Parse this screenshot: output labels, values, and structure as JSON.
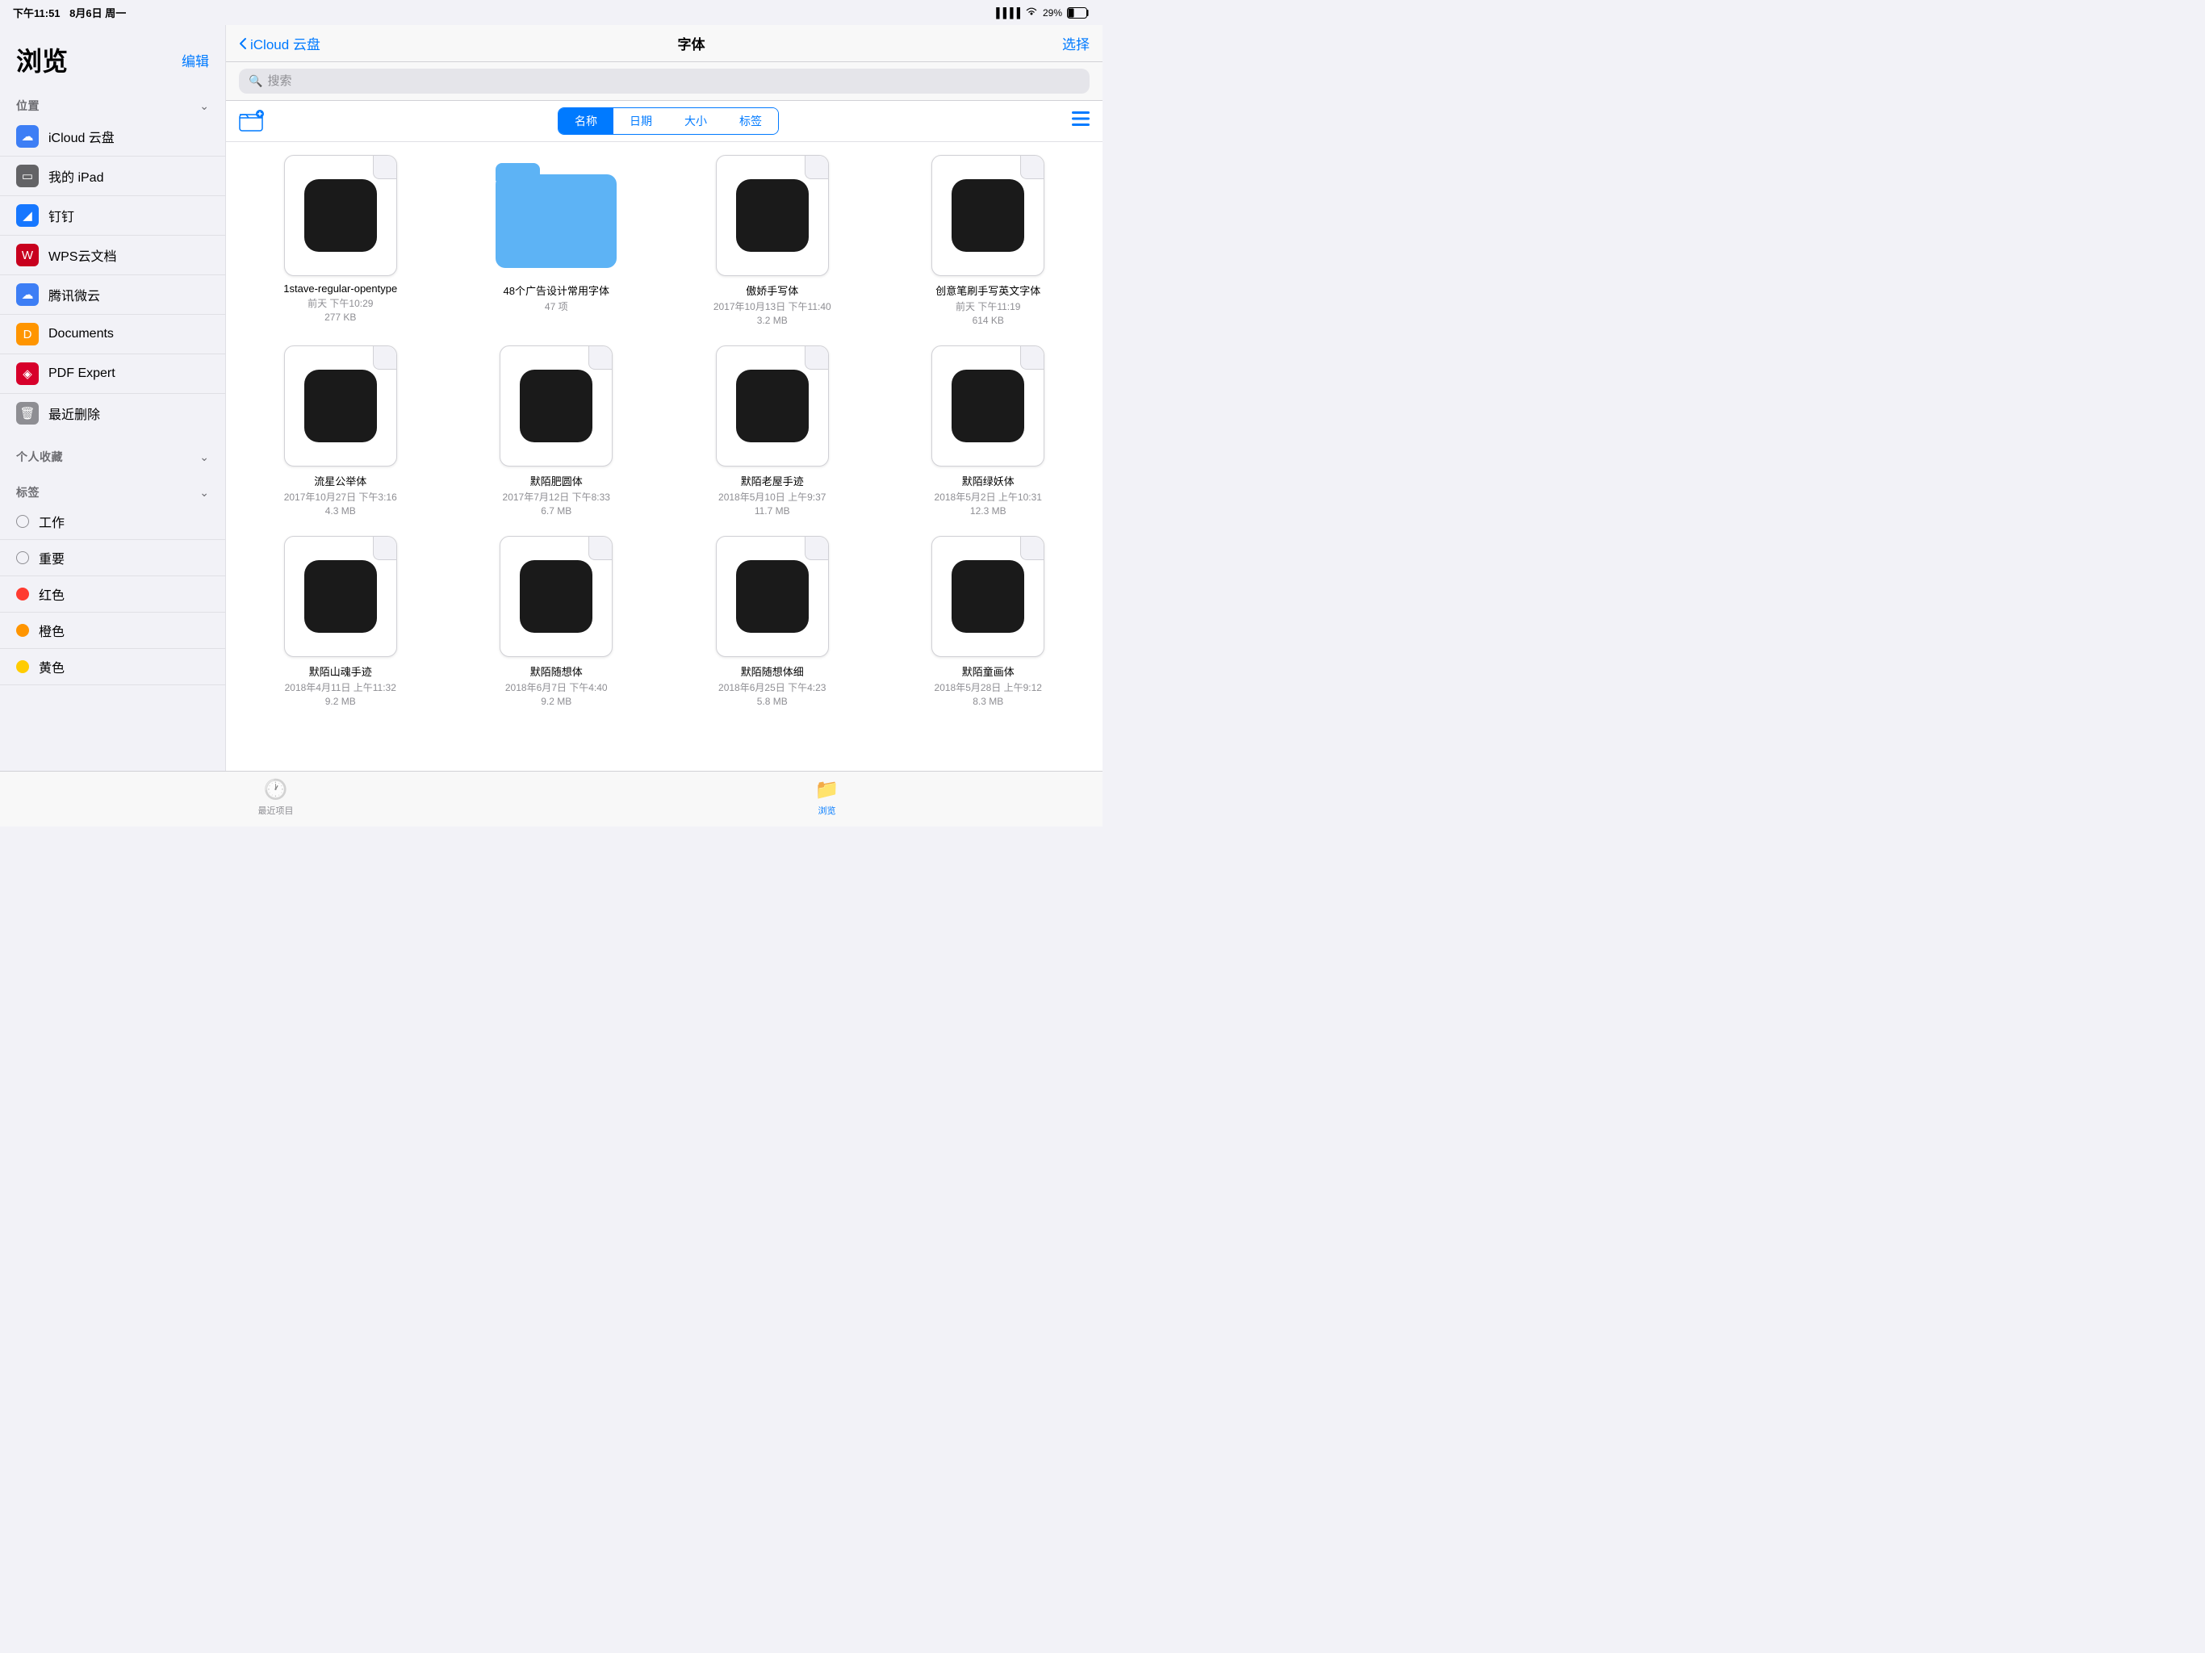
{
  "statusBar": {
    "time": "下午11:51",
    "date": "8月6日 周一",
    "signal": "●●●●",
    "wifi": "WiFi",
    "battery": "29%"
  },
  "sidebar": {
    "title": "浏览",
    "editLabel": "编辑",
    "sections": {
      "locations": "位置",
      "favorites": "个人收藏",
      "tags": "标签"
    },
    "locationItems": [
      {
        "id": "icloud",
        "label": "iCloud 云盘",
        "iconBg": "#3d7ef5",
        "iconColor": "#fff",
        "iconChar": "☁"
      },
      {
        "id": "ipad",
        "label": "我的 iPad",
        "iconBg": "#8e8e93",
        "iconColor": "#fff",
        "iconChar": "▭"
      },
      {
        "id": "dingding",
        "label": "钉钉",
        "iconBg": "#1677ff",
        "iconColor": "#fff",
        "iconChar": "▲"
      },
      {
        "id": "wps",
        "label": "WPS云文档",
        "iconBg": "#c8001e",
        "iconColor": "#fff",
        "iconChar": "W"
      },
      {
        "id": "tencent",
        "label": "腾讯微云",
        "iconBg": "#3d7ef5",
        "iconColor": "#fff",
        "iconChar": "☁"
      },
      {
        "id": "documents",
        "label": "Documents",
        "iconBg": "#ff9500",
        "iconColor": "#fff",
        "iconChar": "D"
      },
      {
        "id": "pdfexpert",
        "label": "PDF Expert",
        "iconBg": "#e5001c",
        "iconColor": "#fff",
        "iconChar": "✦"
      },
      {
        "id": "trash",
        "label": "最近删除",
        "iconBg": "#8e8e93",
        "iconColor": "#fff",
        "iconChar": "🗑"
      }
    ],
    "tags": [
      {
        "id": "work",
        "label": "工作",
        "color": "empty"
      },
      {
        "id": "important",
        "label": "重要",
        "color": "empty"
      },
      {
        "id": "red",
        "label": "红色",
        "color": "#ff3b30"
      },
      {
        "id": "orange",
        "label": "橙色",
        "color": "#ff9500"
      },
      {
        "id": "yellow",
        "label": "黄色",
        "color": "#ffcc00"
      }
    ]
  },
  "header": {
    "backLabel": "iCloud 云盘",
    "title": "字体",
    "selectLabel": "选择"
  },
  "search": {
    "placeholder": "搜索"
  },
  "sortTabs": [
    {
      "id": "name",
      "label": "名称",
      "active": true
    },
    {
      "id": "date",
      "label": "日期",
      "active": false
    },
    {
      "id": "size",
      "label": "大小",
      "active": false
    },
    {
      "id": "tag",
      "label": "标签",
      "active": false
    }
  ],
  "files": [
    {
      "id": "file1",
      "type": "font",
      "name": "1stave-regular-opentype",
      "date": "前天 下午10:29",
      "size": "277 KB"
    },
    {
      "id": "folder1",
      "type": "folder",
      "name": "48个广告设计常用字体",
      "date": "",
      "size": "47 项"
    },
    {
      "id": "file2",
      "type": "font",
      "name": "傲娇手写体",
      "date": "2017年10月13日 下午11:40",
      "size": "3.2 MB"
    },
    {
      "id": "file3",
      "type": "font",
      "name": "创意笔刷手写英文字体",
      "date": "前天 下午11:19",
      "size": "614 KB"
    },
    {
      "id": "file4",
      "type": "font",
      "name": "流星公举体",
      "date": "2017年10月27日 下午3:16",
      "size": "4.3 MB"
    },
    {
      "id": "file5",
      "type": "font",
      "name": "默陌肥圆体",
      "date": "2017年7月12日 下午8:33",
      "size": "6.7 MB"
    },
    {
      "id": "file6",
      "type": "font",
      "name": "默陌老屋手迹",
      "date": "2018年5月10日 上午9:37",
      "size": "11.7 MB"
    },
    {
      "id": "file7",
      "type": "font",
      "name": "默陌绿妖体",
      "date": "2018年5月2日 上午10:31",
      "size": "12.3 MB"
    },
    {
      "id": "file8",
      "type": "font",
      "name": "默陌山魂手迹",
      "date": "2018年4月11日 上午11:32",
      "size": "9.2 MB"
    },
    {
      "id": "file9",
      "type": "font",
      "name": "默陌随想体",
      "date": "2018年6月7日 下午4:40",
      "size": "9.2 MB"
    },
    {
      "id": "file10",
      "type": "font",
      "name": "默陌随想体细",
      "date": "2018年6月25日 下午4:23",
      "size": "5.8 MB"
    },
    {
      "id": "file11",
      "type": "font",
      "name": "默陌童画体",
      "date": "2018年5月28日 上午9:12",
      "size": "8.3 MB"
    }
  ],
  "tabBar": [
    {
      "id": "recents",
      "label": "最近项目",
      "icon": "🕐",
      "active": false
    },
    {
      "id": "browse",
      "label": "浏览",
      "icon": "📁",
      "active": true
    }
  ]
}
